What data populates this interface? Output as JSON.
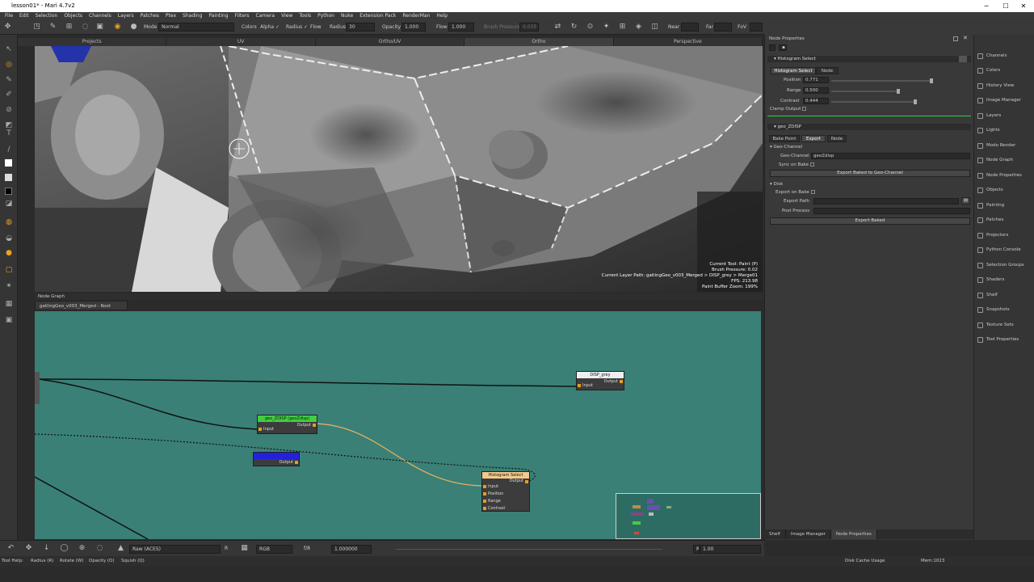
{
  "window": {
    "title": "lesson01* - Mari 4.7v2",
    "min": "─",
    "max": "☐",
    "close": "✕"
  },
  "menu": [
    "File",
    "Edit",
    "Selection",
    "Objects",
    "Channels",
    "Layers",
    "Patches",
    "Ptex",
    "Shading",
    "Painting",
    "Filters",
    "Camera",
    "View",
    "Tools",
    "Python",
    "Nuke",
    "Extension Pack",
    "RenderMan",
    "Help"
  ],
  "toolbar": {
    "mode_label": "Mode",
    "mode_value": "Normal",
    "colors_label": "Colors",
    "alpha_label": "Alpha",
    "radius_label": "Radius",
    "flow_label": "Flow",
    "radius_field_label": "Radius",
    "radius_value": "30",
    "opacity_label": "Opacity",
    "opacity_value": "1.000",
    "flow_field_label": "Flow",
    "flow_value": "1.000",
    "brush_pressure_label": "Brush Pressure",
    "brush_pressure_value": "0.035",
    "near_label": "Near",
    "far_label": "Far",
    "fov_label": "FoV"
  },
  "view_tabs": [
    "Projects",
    "UV",
    "Ortho/UV",
    "Ortho",
    "Perspective"
  ],
  "viewport": {
    "current_tool": "Current Tool: Paint (P)",
    "brush_pressure": "Brush Pressure: 0.02",
    "layer_path": "Current Layer Path: gatlingGeo_v003_Merged > DISP_grey > Merge01",
    "fps": "FPS: 213.98",
    "zoom": "Paint Buffer Zoom: 199%"
  },
  "node_graph": {
    "header": "Node Graph",
    "tab": "gatlingGeo_v003_Merged - Root",
    "nodes": {
      "disp_grey": {
        "title": "DISP_grey",
        "in": "Input",
        "out": "Output"
      },
      "geo_zdisp": {
        "title": "geo_ZDISP (geoZdisp)",
        "in": "Input",
        "out": "Output"
      },
      "blue_node": {
        "title": "geo_Channel",
        "out": "Output"
      },
      "hist": {
        "title": "Histogram Select",
        "out": "Output",
        "ports": [
          "Input",
          "Position",
          "Range",
          "Contrast"
        ]
      }
    }
  },
  "bottom": {
    "colorspace": "Raw (ACES)",
    "channel": "RGB",
    "fstop": "f/8",
    "gain": "1.000000",
    "exposure_r": "R",
    "exposure_value": "1.00"
  },
  "statusbar": {
    "tool_help": "Tool Help:",
    "radius": "Radius (R)",
    "rotate": "Rotate (W)",
    "opacity": "Opacity (O)",
    "squish": "Squish (Q)",
    "disk_cache": "Disk Cache Usage",
    "mem": "Mem:1023"
  },
  "props": {
    "header": "Node Properties",
    "hist_section": "Histogram Select",
    "hist_tab1": "Histogram Select",
    "hist_tab2": "Node",
    "position_label": "Position",
    "position_value": "0.771",
    "range_label": "Range",
    "range_value": "0.500",
    "contrast_label": "Contrast",
    "contrast_value": "0.444",
    "clamp_label": "Clamp Output",
    "geo_section": "geo_ZDISP",
    "geo_tab1": "Bake Point",
    "geo_tab2": "Export",
    "geo_tab3": "Node",
    "geo_channel_section": "Geo-Channel",
    "geo_channel_label": "Geo-Channel",
    "geo_channel_value": "geoZdisp",
    "sync_label": "Sync on Bake",
    "export_baked_geo": "Export Baked to Geo-Channel",
    "disk_section": "Disk",
    "export_on_bake": "Export on Bake",
    "export_path": "Export Path",
    "post_process": "Post Process",
    "export_baked": "Export Baked"
  },
  "shelf_tabs": [
    "Shelf",
    "Image Manager",
    "Node Properties"
  ],
  "palettes": [
    "Channels",
    "Colors",
    "History View",
    "Image Manager",
    "Layers",
    "Lights",
    "Modo Render",
    "Node Graph",
    "Node Properties",
    "Objects",
    "Painting",
    "Patches",
    "Projectors",
    "Python Console",
    "Selection Groups",
    "Shaders",
    "Shelf",
    "Snapshots",
    "Texture Sets",
    "Tool Properties"
  ],
  "colors": {
    "nodegraph_bg": "#3a8076",
    "wire_orange": "#f0b060",
    "node_green": "#44cc44",
    "node_blue": "#2222dd"
  }
}
